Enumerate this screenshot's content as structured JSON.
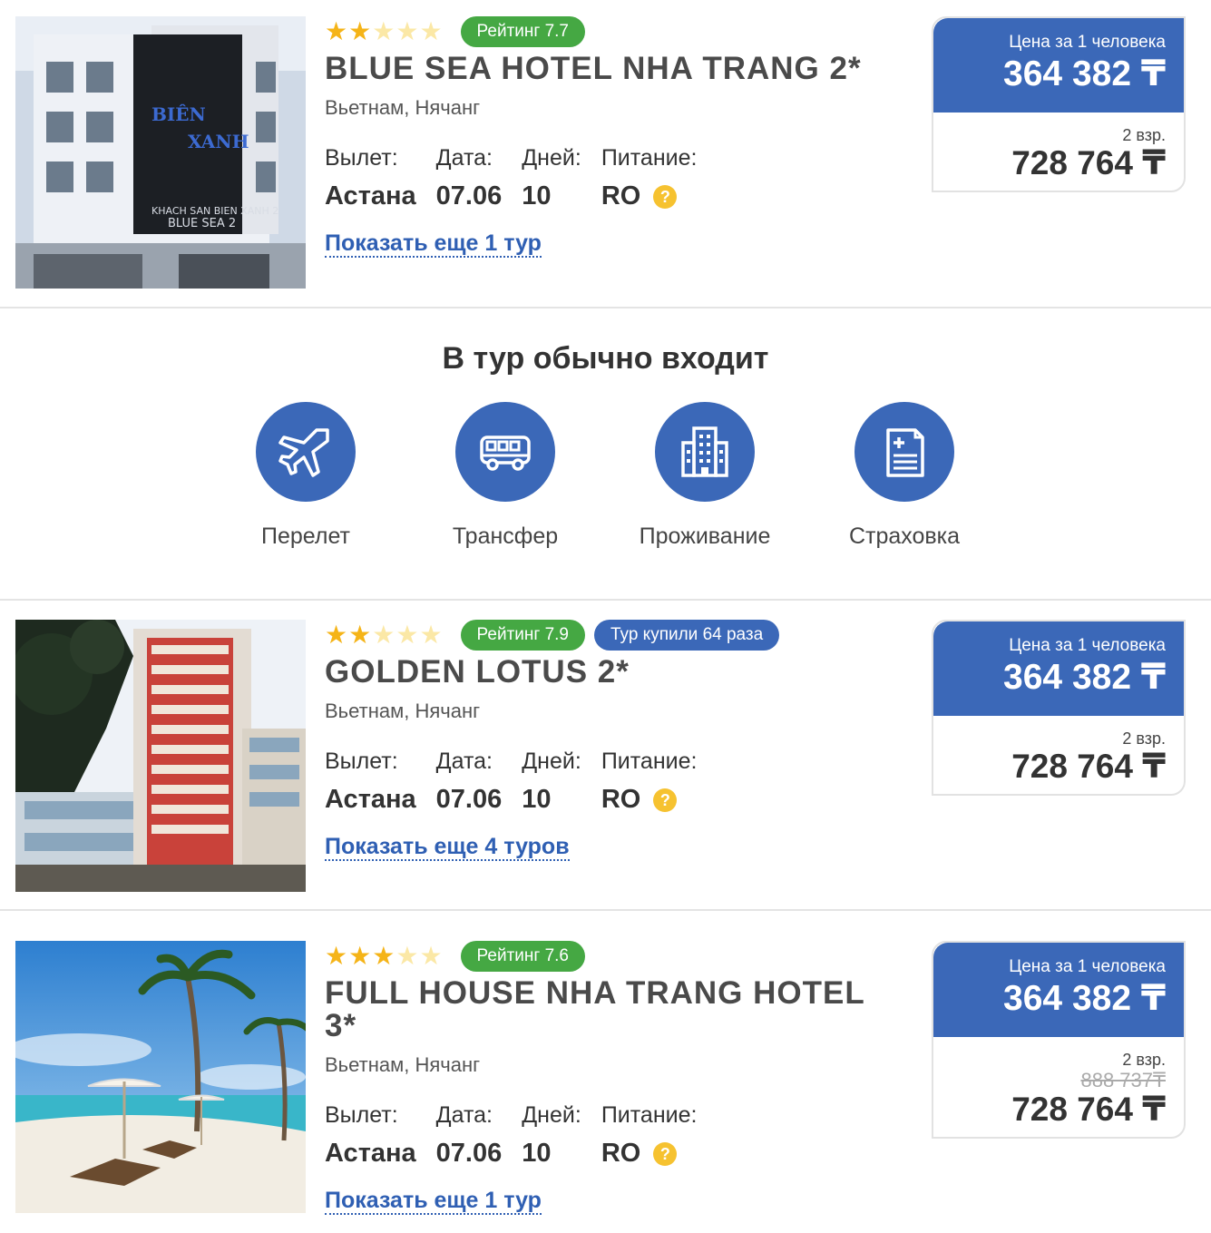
{
  "hotels": [
    {
      "stars_filled": 2,
      "stars_total": 5,
      "rating_label": "Рейтинг 7.7",
      "name": "BLUE SEA HOTEL NHA TRANG 2*",
      "location": "Вьетнам, Нячанг",
      "fact_labels": {
        "departure": "Вылет:",
        "date": "Дата:",
        "days": "Дней:",
        "meal": "Питание:"
      },
      "departure": "Астана",
      "date": "07.06",
      "days": "10",
      "meal": "RO",
      "more_link": "Показать еще 1 тур",
      "price_caption": "Цена за 1 человека",
      "price_per_person": "364 382 ₸",
      "guests_caption": "2 взр.",
      "price_total": "728 764 ₸",
      "photo": "hotel-facade-bien-xanh"
    },
    {
      "stars_filled": 2,
      "stars_total": 5,
      "rating_label": "Рейтинг 7.9",
      "bought_label": "Тур купили 64 раза",
      "name": "GOLDEN LOTUS 2*",
      "location": "Вьетнам, Нячанг",
      "fact_labels": {
        "departure": "Вылет:",
        "date": "Дата:",
        "days": "Дней:",
        "meal": "Питание:"
      },
      "departure": "Астана",
      "date": "07.06",
      "days": "10",
      "meal": "RO",
      "more_link": "Показать еще 4 туров",
      "price_caption": "Цена за 1 человека",
      "price_per_person": "364 382 ₸",
      "guests_caption": "2 взр.",
      "price_total": "728 764 ₸",
      "photo": "tall-red-hotel-tower"
    },
    {
      "stars_filled": 3,
      "stars_total": 5,
      "rating_label": "Рейтинг 7.6",
      "name": "FULL HOUSE NHA TRANG HOTEL 3*",
      "location": "Вьетнам, Нячанг",
      "fact_labels": {
        "departure": "Вылет:",
        "date": "Дата:",
        "days": "Дней:",
        "meal": "Питание:"
      },
      "departure": "Астана",
      "date": "07.06",
      "days": "10",
      "meal": "RO",
      "more_link": "Показать еще 1 тур",
      "price_caption": "Цена за 1 человека",
      "price_per_person": "364 382 ₸",
      "guests_caption": "2 взр.",
      "old_price": "888 737₸",
      "price_total": "728 764 ₸",
      "photo": "beach-with-palms"
    }
  ],
  "included": {
    "title": "В тур обычно входит",
    "items": [
      {
        "label": "Перелет",
        "icon": "airplane-icon"
      },
      {
        "label": "Трансфер",
        "icon": "bus-icon"
      },
      {
        "label": "Проживание",
        "icon": "building-icon"
      },
      {
        "label": "Страховка",
        "icon": "insurance-document-icon"
      }
    ]
  },
  "colors": {
    "brand_blue": "#3b68b8",
    "rating_green": "#45a843",
    "star_gold": "#f5b418",
    "link_blue": "#2f5fb3"
  }
}
